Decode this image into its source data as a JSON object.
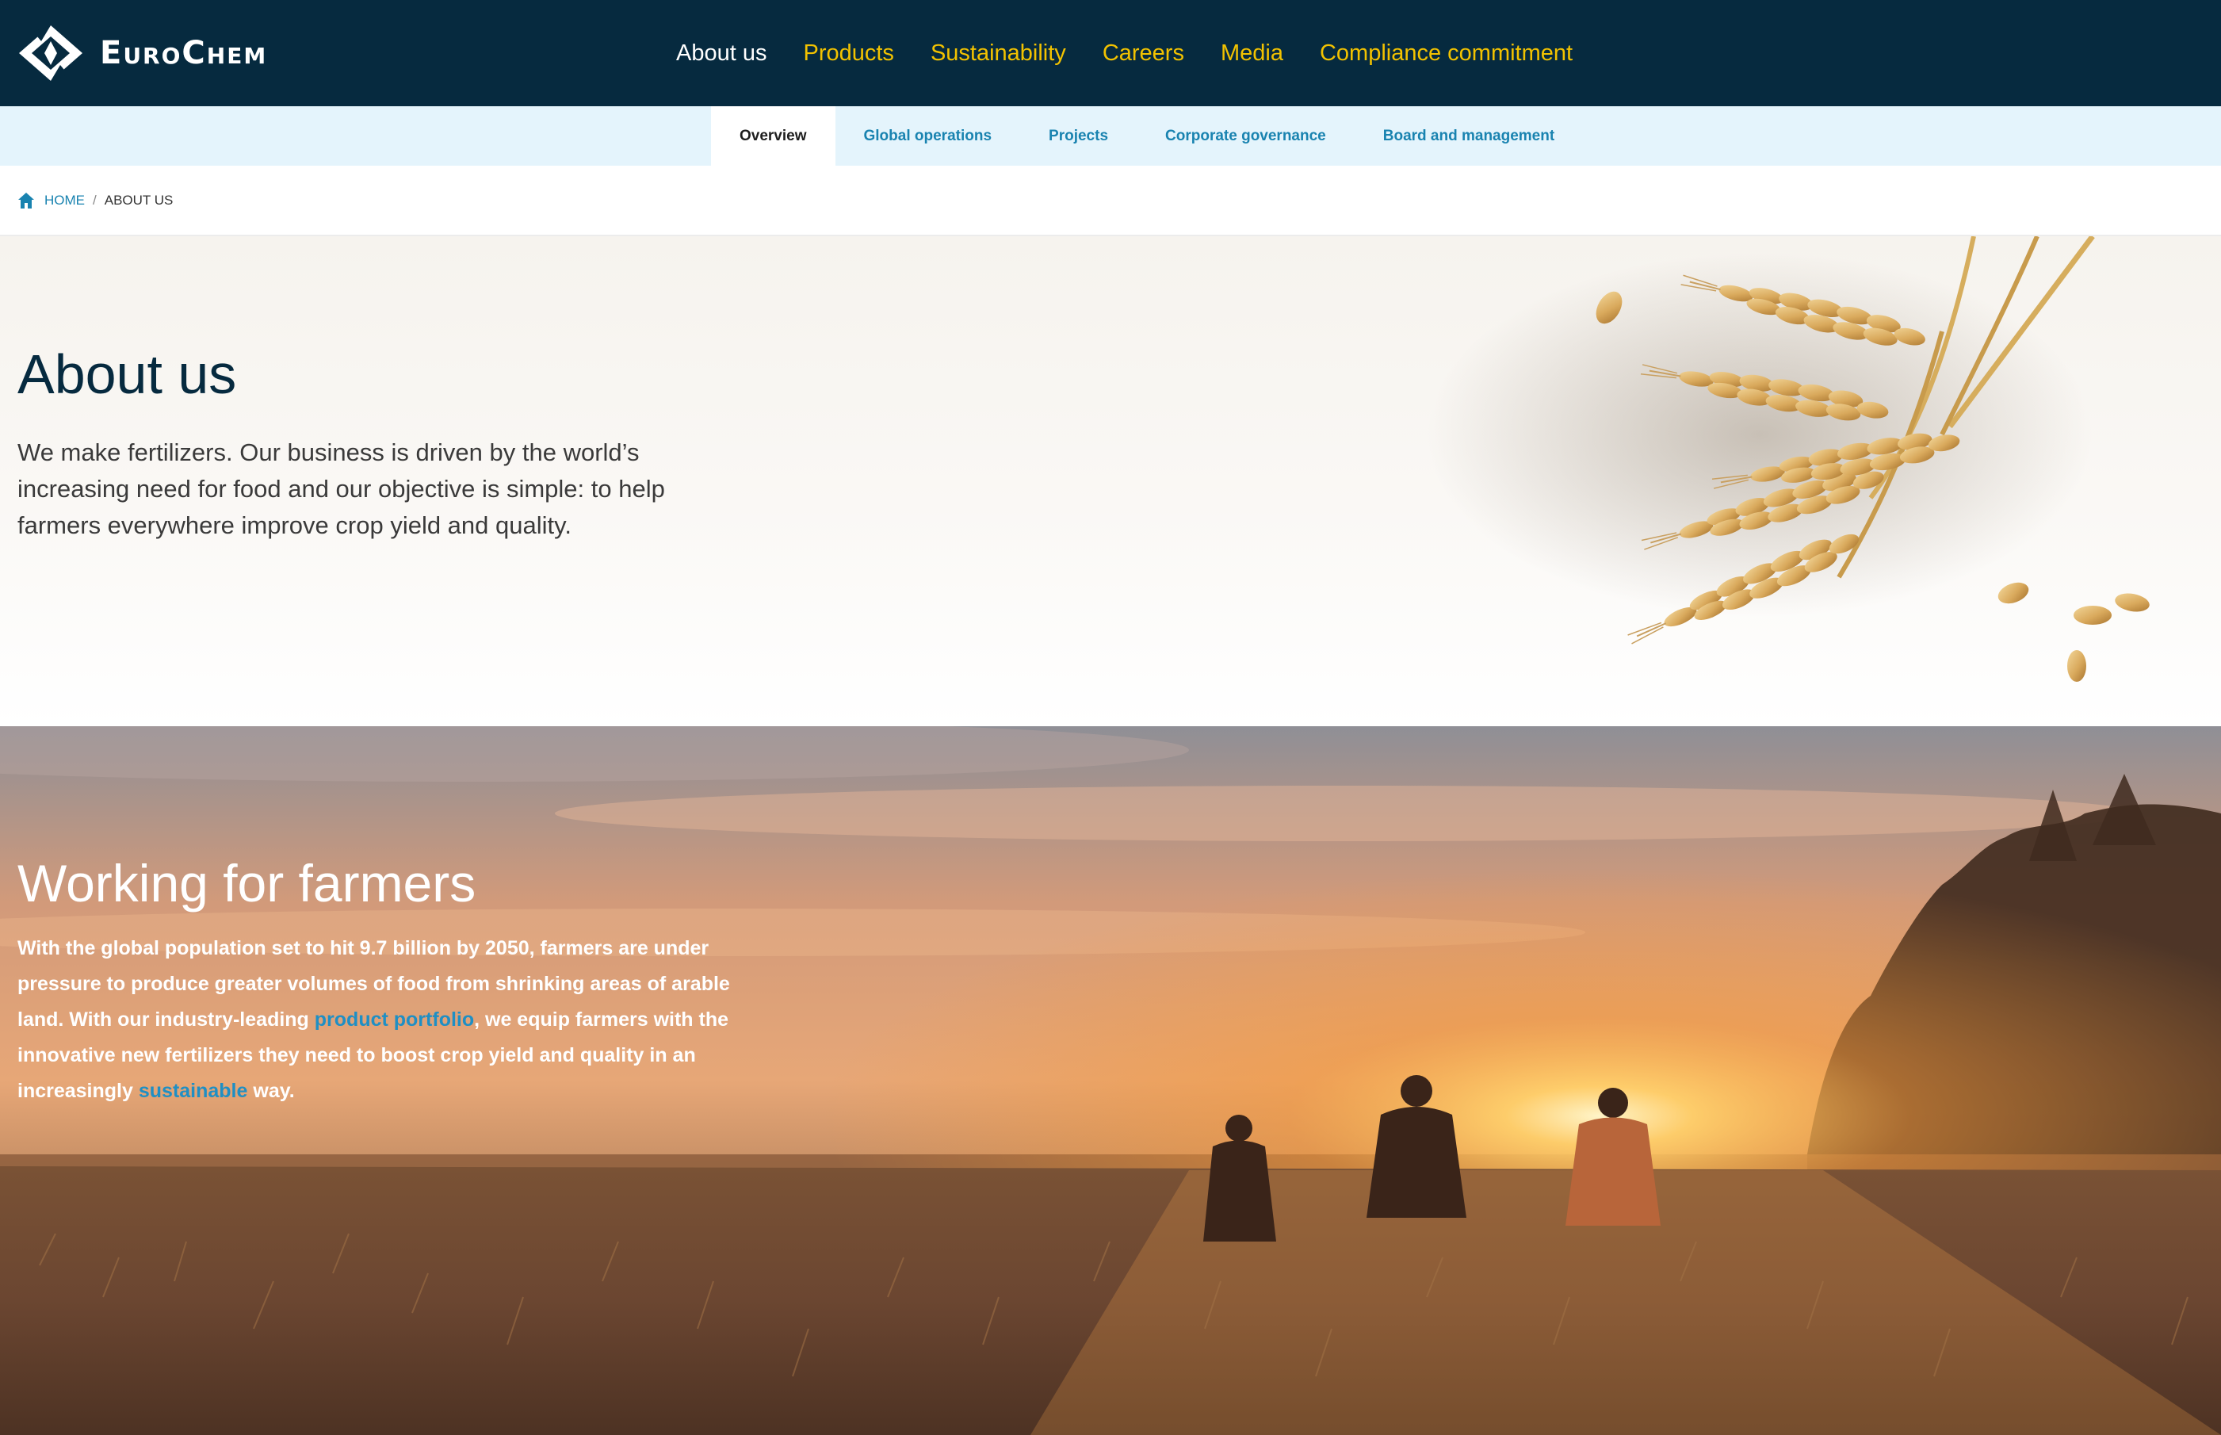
{
  "brand": {
    "name": "EuroChem",
    "logo_icon": "eurochem-diamond-logo-icon",
    "colors": {
      "header_bg": "#062a3f",
      "nav_link": "#f2c200",
      "nav_active": "#ffffff",
      "subnav_bg": "#e4f4fc",
      "link_blue": "#1983b0",
      "title_navy": "#062a3f"
    }
  },
  "main_nav": {
    "items": [
      {
        "label": "About us",
        "active": true
      },
      {
        "label": "Products",
        "active": false
      },
      {
        "label": "Sustainability",
        "active": false
      },
      {
        "label": "Careers",
        "active": false
      },
      {
        "label": "Media",
        "active": false
      },
      {
        "label": "Compliance commitment",
        "active": false
      }
    ]
  },
  "sub_nav": {
    "items": [
      {
        "label": "Overview",
        "active": true
      },
      {
        "label": "Global operations",
        "active": false
      },
      {
        "label": "Projects",
        "active": false
      },
      {
        "label": "Corporate governance",
        "active": false
      },
      {
        "label": "Board and management",
        "active": false
      }
    ]
  },
  "breadcrumb": {
    "icon": "home-icon",
    "home": "HOME",
    "separator": "/",
    "current": "ABOUT US"
  },
  "about": {
    "title": "About us",
    "text": "We make fertilizers. Our business is driven by the world’s increasing need for food and our objective is simple: to help farmers everywhere improve crop yield and quality.",
    "image": "wheat-ears-image"
  },
  "farmers": {
    "title": "Working for farmers",
    "text_1": "With the global population set to hit 9.7 billion by 2050, farmers are under pressure to produce greater volumes of food from shrinking areas of arable land. With our industry-leading ",
    "link_1": "product portfolio",
    "text_2": ", we equip farmers with the innovative new fertilizers they need to boost crop yield and quality in an increasingly ",
    "link_2": "sustainable",
    "text_3": " way.",
    "image": "sunset-field-farmers-image"
  }
}
